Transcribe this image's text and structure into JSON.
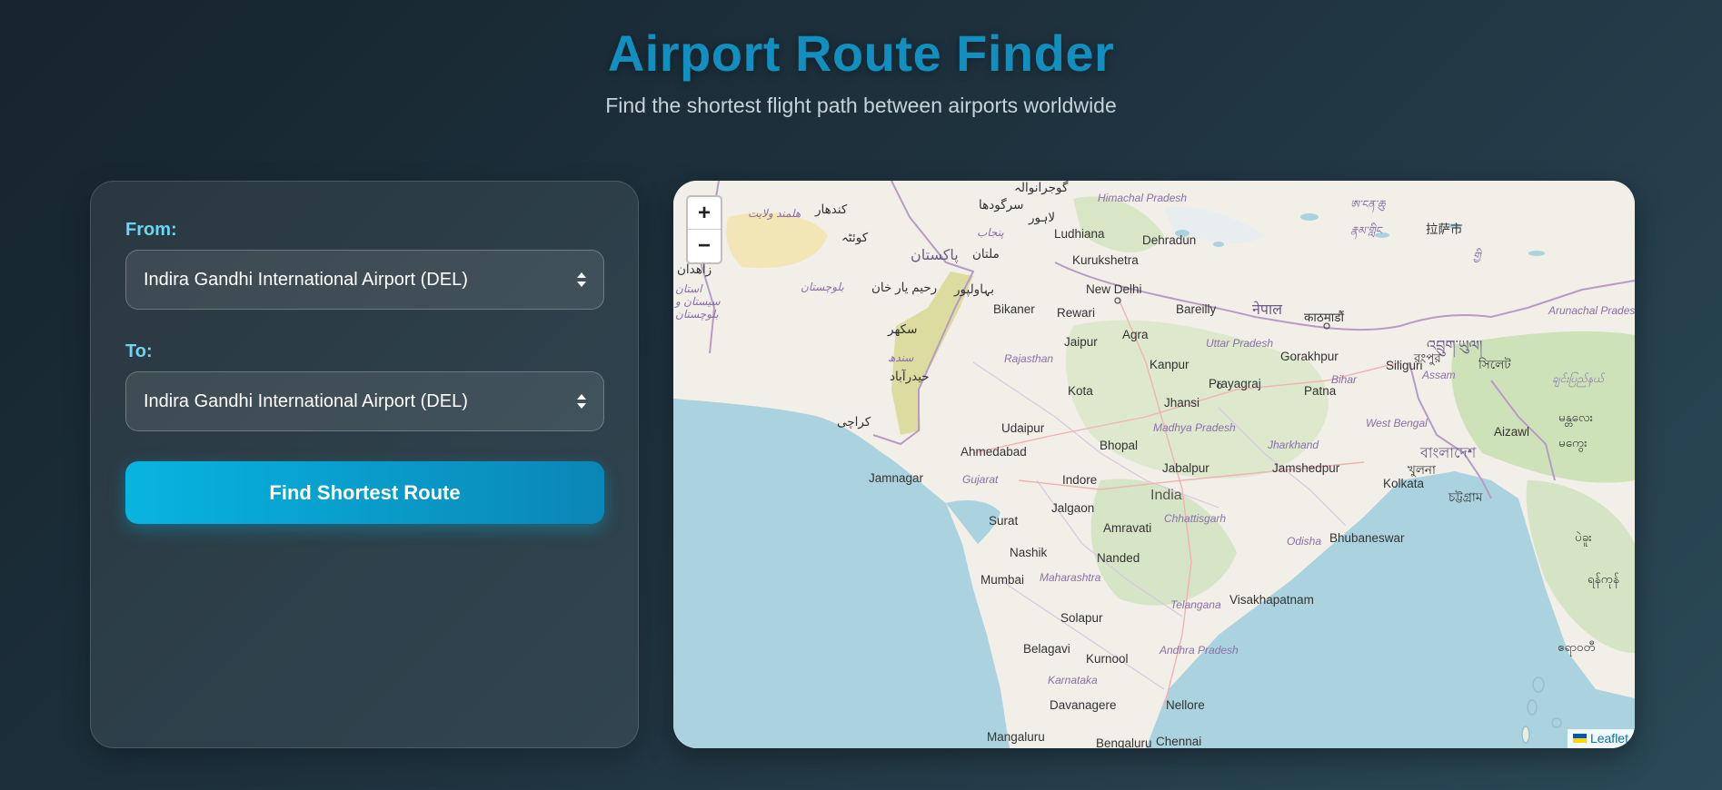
{
  "header": {
    "title": "Airport Route Finder",
    "subtitle": "Find the shortest flight path between airports worldwide"
  },
  "form": {
    "from_label": "From:",
    "from_value": "Indira Gandhi International Airport (DEL)",
    "to_label": "To:",
    "to_value": "Indira Gandhi International Airport (DEL)",
    "submit_label": "Find Shortest Route"
  },
  "map": {
    "zoom_in": "+",
    "zoom_out": "−",
    "attribution": "Leaflet",
    "labels": {
      "ludhiana": "Ludhiana",
      "dehradun": "Dehradun",
      "kurukshetra": "Kurukshetra",
      "new_delhi": "New Delhi",
      "bikaner": "Bikaner",
      "rewari": "Rewari",
      "bareilly": "Bareilly",
      "agra": "Agra",
      "jaipur": "Jaipur",
      "kanpur": "Kanpur",
      "gorakhpur": "Gorakhpur",
      "siliguri": "Siliguri",
      "prayagraj": "Prayagraj",
      "kota": "Kota",
      "patna": "Patna",
      "jhansi": "Jhansi",
      "aizawl": "Aizawl",
      "udaipur": "Udaipur",
      "ahmedabad": "Ahmedabad",
      "bhopal": "Bhopal",
      "jamnagar": "Jamnagar",
      "indore": "Indore",
      "jabalpur": "Jabalpur",
      "jamshedpur": "Jamshedpur",
      "kolkata": "Kolkata",
      "india": "India",
      "jalgaon": "Jalgaon",
      "surat": "Surat",
      "amravati": "Amravati",
      "bhubaneswar": "Bhubaneswar",
      "nashik": "Nashik",
      "nanded": "Nanded",
      "mumbai": "Mumbai",
      "visakhapatnam": "Visakhapatnam",
      "solapur": "Solapur",
      "belagavi": "Belagavi",
      "kurnool": "Kurnool",
      "davanagere": "Davanagere",
      "nellore": "Nellore",
      "mangaluru": "Mangaluru",
      "bengaluru": "Bengaluru",
      "chennai": "Chennai",
      "himachal_pradesh": "Himachal Pradesh",
      "uttar_pradesh": "Uttar Pradesh",
      "rajasthan": "Rajasthan",
      "madhya_pradesh": "Madhya Pradesh",
      "gujarat": "Gujarat",
      "bihar": "Bihar",
      "west_bengal": "West Bengal",
      "jharkhand": "Jharkhand",
      "chhattisgarh": "Chhattisgarh",
      "odisha": "Odisha",
      "maharashtra": "Maharashtra",
      "telangana": "Telangana",
      "andhra_pradesh": "Andhra Pradesh",
      "karnataka": "Karnataka",
      "assam": "Assam",
      "arunachal_pradesh": "Arunachal Pradesh",
      "pakistan": "پاکستان",
      "nepal": "नेपाल",
      "kathmandu": "काठमाडौं",
      "bangladesh": "বাংলাদেশ",
      "bhutan": "འབྲུག་ཡུལ།",
      "karachi": "کراچی",
      "quetta": "کوئٹہ",
      "multan": "ملتان",
      "bahawalpur": "بہاولپور",
      "lahore": "لاہور",
      "sukkur": "سکھر",
      "hyderabad_pk": "حیدرآباد",
      "sargodha": "سرگودھا",
      "gujranwala": "گوجرانوالہ",
      "kandahar": "کندهار",
      "helmand": "هلمند ولايت",
      "zahedan": "زاهدان",
      "baluchistan_ir": "استان سیستان و بلوچستان",
      "balochistan": "بلوچستان",
      "rahim_yar_khan": "رحیم یار خان",
      "punjab_pk": "پنجاب",
      "sindh": "سندھ",
      "khulna": "খুলনা",
      "chattogram": "চট্টগ্রাম",
      "sylhet": "সিলেট",
      "rangpur": "রংপুর",
      "lhasa": "拉萨市",
      "myanmar_region": "မန္တလေး",
      "chin": "ချင်းပြည်နယ်",
      "magway": "မကွေး",
      "bago": "ပဲခူး",
      "yangon": "ရန်ကုန်",
      "ayeyarwady": "ဧရာဝတီ",
      "tibet_1": "ཨ་ངན་ཆུ",
      "tibet_2": "རྣམ་གླིང",
      "tibet_3": "གྱི"
    }
  }
}
